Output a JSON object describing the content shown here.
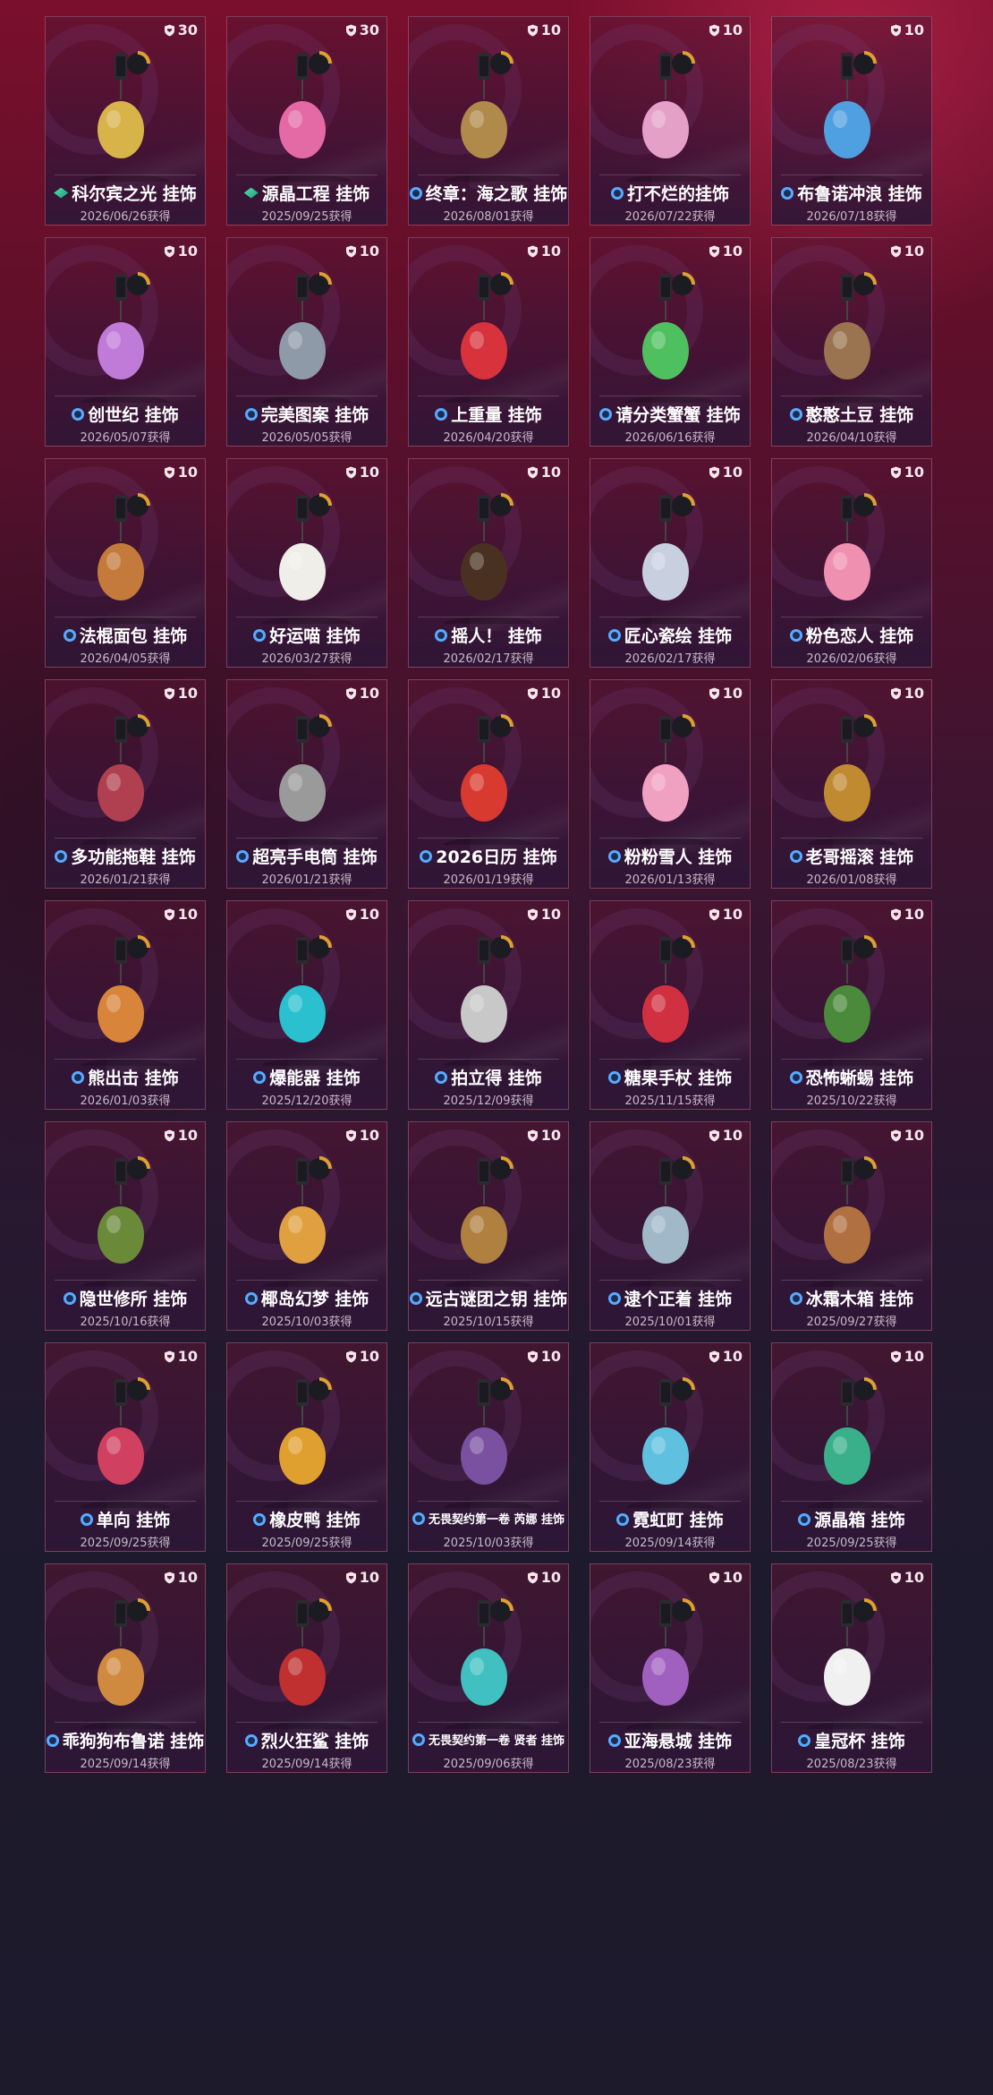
{
  "cards": [
    {
      "name": "科尔宾之光 挂饰",
      "date": "2026/06/26获得",
      "points": "30",
      "tier": "green",
      "art": "#d8b34a"
    },
    {
      "name": "源晶工程 挂饰",
      "date": "2025/09/25获得",
      "points": "30",
      "tier": "green",
      "art": "#e46aa6"
    },
    {
      "name": "终章：海之歌 挂饰",
      "date": "2026/08/01获得",
      "points": "10",
      "tier": "blue",
      "art": "#b08a4a"
    },
    {
      "name": "打不烂的挂饰",
      "date": "2026/07/22获得",
      "points": "10",
      "tier": "blue",
      "art": "#e5a0c8"
    },
    {
      "name": "布鲁诺冲浪 挂饰",
      "date": "2026/07/18获得",
      "points": "10",
      "tier": "blue",
      "art": "#4fa0e0"
    },
    {
      "name": "创世纪 挂饰",
      "date": "2026/05/07获得",
      "points": "10",
      "tier": "blue",
      "art": "#c07ad8"
    },
    {
      "name": "完美图案 挂饰",
      "date": "2026/05/05获得",
      "points": "10",
      "tier": "blue",
      "art": "#8f9aa8"
    },
    {
      "name": "上重量 挂饰",
      "date": "2026/04/20获得",
      "points": "10",
      "tier": "blue",
      "art": "#d8323c"
    },
    {
      "name": "请分类蟹蟹 挂饰",
      "date": "2026/06/16获得",
      "points": "10",
      "tier": "blue",
      "art": "#4fc060"
    },
    {
      "name": "憨憨土豆 挂饰",
      "date": "2026/04/10获得",
      "points": "10",
      "tier": "blue",
      "art": "#9a7450"
    },
    {
      "name": "法棍面包 挂饰",
      "date": "2026/04/05获得",
      "points": "10",
      "tier": "blue",
      "art": "#c47a3a"
    },
    {
      "name": "好运喵 挂饰",
      "date": "2026/03/27获得",
      "points": "10",
      "tier": "blue",
      "art": "#f0eee8"
    },
    {
      "name": "摇人！ 挂饰",
      "date": "2026/02/17获得",
      "points": "10",
      "tier": "blue",
      "art": "#4a3020"
    },
    {
      "name": "匠心瓷绘 挂饰",
      "date": "2026/02/17获得",
      "points": "10",
      "tier": "blue",
      "art": "#c8d0e0"
    },
    {
      "name": "粉色恋人 挂饰",
      "date": "2026/02/06获得",
      "points": "10",
      "tier": "blue",
      "art": "#f090b0"
    },
    {
      "name": "多功能拖鞋 挂饰",
      "date": "2026/01/21获得",
      "points": "10",
      "tier": "blue",
      "art": "#b04050"
    },
    {
      "name": "超亮手电筒 挂饰",
      "date": "2026/01/21获得",
      "points": "10",
      "tier": "blue",
      "art": "#9a9a9a"
    },
    {
      "name": "2026日历 挂饰",
      "date": "2026/01/19获得",
      "points": "10",
      "tier": "blue",
      "art": "#d83a30"
    },
    {
      "name": "粉粉雪人 挂饰",
      "date": "2026/01/13获得",
      "points": "10",
      "tier": "blue",
      "art": "#f0a0c0"
    },
    {
      "name": "老哥摇滚 挂饰",
      "date": "2026/01/08获得",
      "points": "10",
      "tier": "blue",
      "art": "#c08a30"
    },
    {
      "name": "熊出击 挂饰",
      "date": "2026/01/03获得",
      "points": "10",
      "tier": "blue",
      "art": "#d8843a"
    },
    {
      "name": "爆能器 挂饰",
      "date": "2025/12/20获得",
      "points": "10",
      "tier": "blue",
      "art": "#2ac0d0"
    },
    {
      "name": "拍立得 挂饰",
      "date": "2025/12/09获得",
      "points": "10",
      "tier": "blue",
      "art": "#c8c8c8"
    },
    {
      "name": "糖果手杖 挂饰",
      "date": "2025/11/15获得",
      "points": "10",
      "tier": "blue",
      "art": "#d03040"
    },
    {
      "name": "恐怖蜥蜴 挂饰",
      "date": "2025/10/22获得",
      "points": "10",
      "tier": "blue",
      "art": "#4a8a3a"
    },
    {
      "name": "隐世修所 挂饰",
      "date": "2025/10/16获得",
      "points": "10",
      "tier": "blue",
      "art": "#6a8a3a"
    },
    {
      "name": "椰岛幻梦 挂饰",
      "date": "2025/10/03获得",
      "points": "10",
      "tier": "blue",
      "art": "#e0a040"
    },
    {
      "name": "远古谜团之钥 挂饰",
      "date": "2025/10/15获得",
      "points": "10",
      "tier": "blue",
      "art": "#b08040"
    },
    {
      "name": "逮个正着 挂饰",
      "date": "2025/10/01获得",
      "points": "10",
      "tier": "blue",
      "art": "#a0b8c8"
    },
    {
      "name": "冰霜木箱 挂饰",
      "date": "2025/09/27获得",
      "points": "10",
      "tier": "blue",
      "art": "#b07040"
    },
    {
      "name": "单向 挂饰",
      "date": "2025/09/25获得",
      "points": "10",
      "tier": "blue",
      "art": "#d04060"
    },
    {
      "name": "橡皮鸭 挂饰",
      "date": "2025/09/25获得",
      "points": "10",
      "tier": "blue",
      "art": "#e0a030"
    },
    {
      "name": "无畏契约第一卷 芮娜 挂饰",
      "date": "2025/10/03获得",
      "points": "10",
      "tier": "blue",
      "art": "#7a50a0",
      "small": true
    },
    {
      "name": "霓虹町 挂饰",
      "date": "2025/09/14获得",
      "points": "10",
      "tier": "blue",
      "art": "#60c0e0"
    },
    {
      "name": "源晶箱 挂饰",
      "date": "2025/09/25获得",
      "points": "10",
      "tier": "blue",
      "art": "#3ab08a"
    },
    {
      "name": "乖狗狗布鲁诺 挂饰",
      "date": "2025/09/14获得",
      "points": "10",
      "tier": "blue",
      "art": "#d08a40"
    },
    {
      "name": "烈火狂鲨 挂饰",
      "date": "2025/09/14获得",
      "points": "10",
      "tier": "blue",
      "art": "#c03030"
    },
    {
      "name": "无畏契约第一卷 贤者 挂饰",
      "date": "2025/09/06获得",
      "points": "10",
      "tier": "blue",
      "art": "#40c0c0",
      "small": true
    },
    {
      "name": "亚海悬城 挂饰",
      "date": "2025/08/23获得",
      "points": "10",
      "tier": "blue",
      "art": "#a060c0"
    },
    {
      "name": "皇冠杯 挂饰",
      "date": "2025/08/23获得",
      "points": "10",
      "tier": "blue",
      "art": "#f0f0f0"
    }
  ]
}
